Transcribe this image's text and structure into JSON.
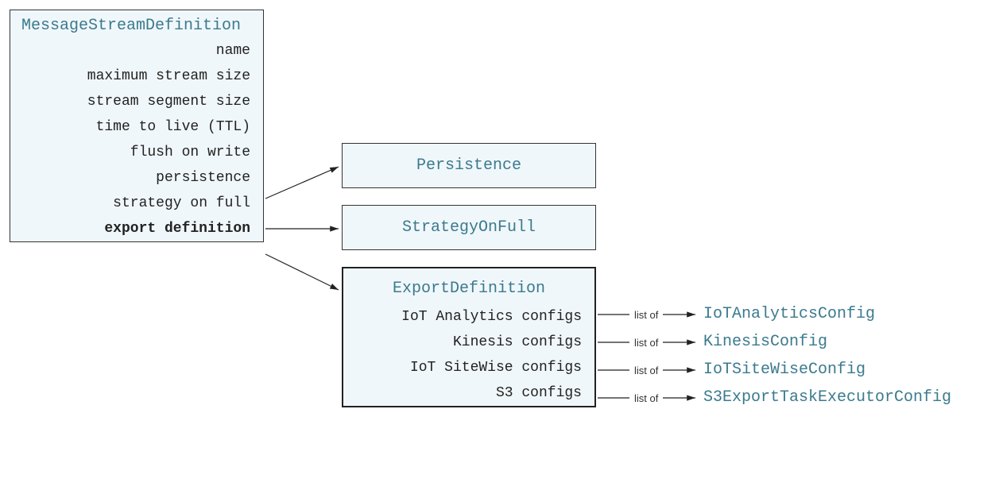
{
  "main": {
    "title": "MessageStreamDefinition",
    "props": [
      "name",
      "maximum stream size",
      "stream segment size",
      "time to live (TTL)",
      "flush on write",
      "persistence",
      "strategy on full",
      "export definition"
    ]
  },
  "persistence": {
    "title": "Persistence"
  },
  "strategy": {
    "title": "StrategyOnFull"
  },
  "export": {
    "title": "ExportDefinition",
    "rows": [
      "IoT Analytics configs",
      "Kinesis configs",
      "IoT SiteWise configs",
      "S3 configs"
    ]
  },
  "listof_label": "list of",
  "types": [
    "IoTAnalyticsConfig",
    "KinesisConfig",
    "IoTSiteWiseConfig",
    "S3ExportTaskExecutorConfig"
  ]
}
